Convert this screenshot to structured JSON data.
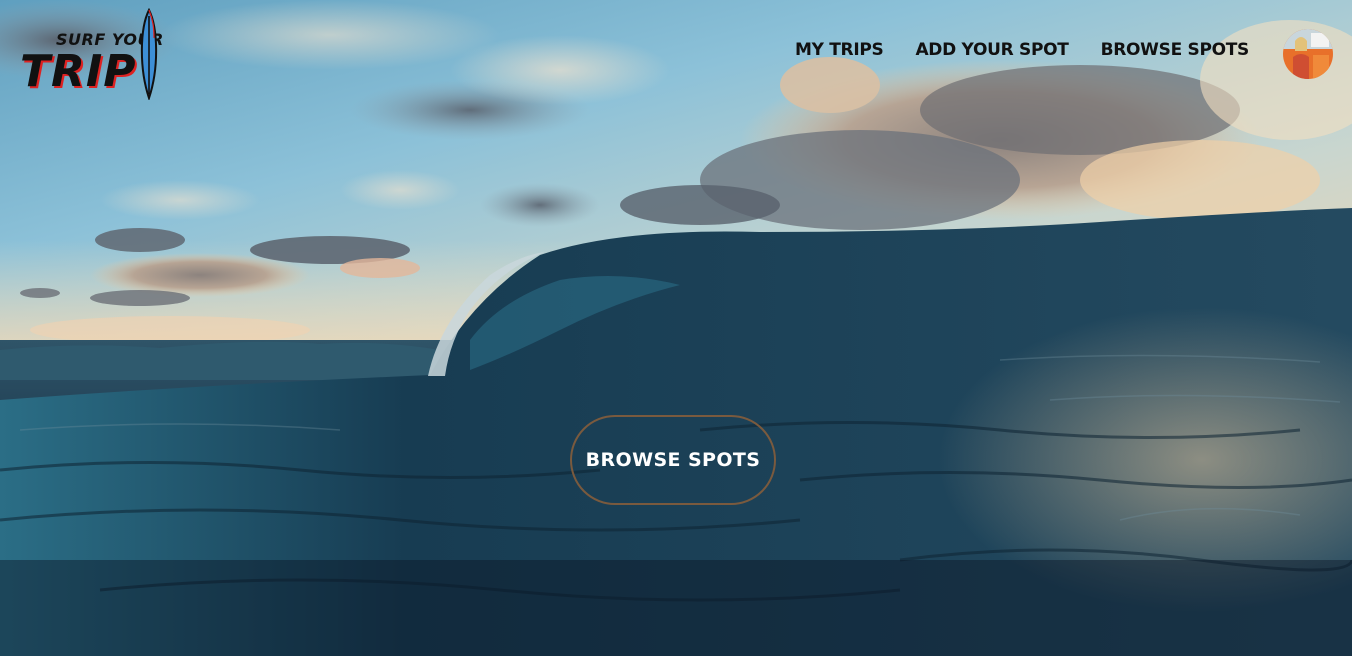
{
  "logo": {
    "line1": "SURF YOUR",
    "line2": "TRIP"
  },
  "nav": {
    "items": [
      {
        "label": "MY TRIPS"
      },
      {
        "label": "ADD YOUR SPOT"
      },
      {
        "label": "BROWSE SPOTS"
      }
    ]
  },
  "hero": {
    "cta_label": "BROWSE SPOTS"
  },
  "colors": {
    "nav_text": "#111111",
    "cta_border": "#7a5a3e",
    "cta_text": "#ffffff",
    "logo_accent": "#dd2222",
    "surfboard": "#3d8fd6"
  }
}
